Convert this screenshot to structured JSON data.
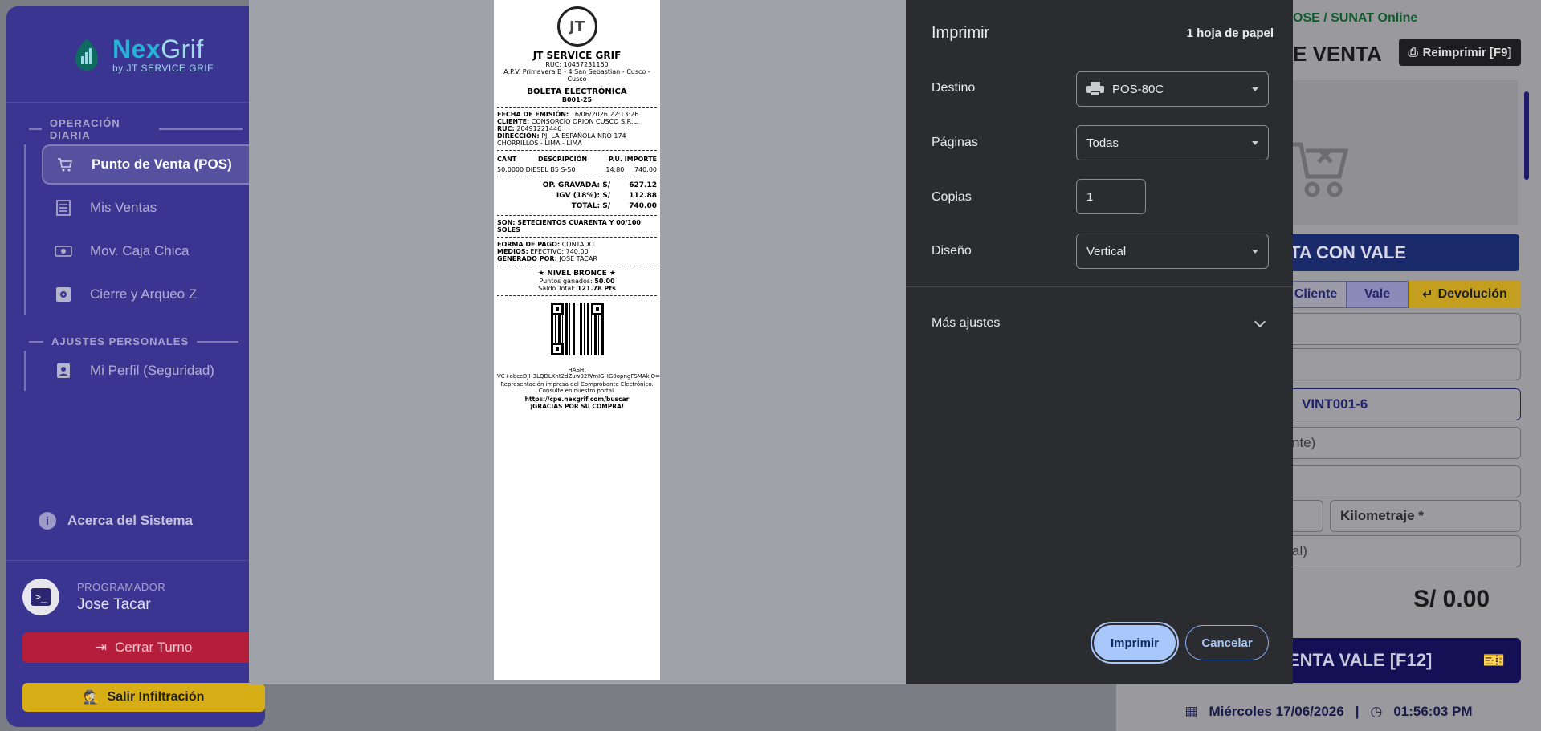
{
  "sidebar": {
    "brand_nex": "Nex",
    "brand_grif": "Grif",
    "brand_sub": "by JT SERVICE GRIF",
    "section_daily": "OPERACIÓN DIARIA",
    "daily_items": [
      {
        "label": "Punto de Venta (POS)",
        "icon": "cart-icon"
      },
      {
        "label": "Mis Ventas",
        "icon": "receipt-icon"
      },
      {
        "label": "Mov. Caja Chica",
        "icon": "cash-icon"
      },
      {
        "label": "Cierre y Arqueo Z",
        "icon": "safe-icon"
      }
    ],
    "section_personal": "AJUSTES PERSONALES",
    "personal_items": [
      {
        "label": "Mi Perfil (Seguridad)",
        "icon": "id-badge-icon"
      }
    ],
    "about": "Acerca del Sistema",
    "user_role": "PROGRAMADOR",
    "user_name": "Jose Tacar",
    "logout_label": "Cerrar Turno",
    "exit_label": "Salir Infiltración"
  },
  "right": {
    "status": "OSE / SUNAT Online",
    "title_partial": "E VENTA",
    "reprint": "Reimprimir [F9]",
    "banner": "TA CON VALE",
    "tabs": [
      "Cliente",
      "Vale",
      "Devolución"
    ],
    "field_vale": "VINT001-6",
    "field_client": "nte)",
    "field_km": "Kilometraje *",
    "field_total_label": "al)",
    "total": "S/ 0.00",
    "sell_button": "ENTA VALE [F12]",
    "date": "Miércoles 17/06/2026",
    "time": "01:56:03 PM"
  },
  "receipt": {
    "logo_text": "JT",
    "company": "JT SERVICE GRIF",
    "ruc": "RUC: 10457231160",
    "address": "A.P.V. Primavera B - 4 San Sebastian - Cusco - Cusco",
    "doc_type": "BOLETA ELECTRÓNICA",
    "doc_number": "B001-25",
    "issue_label": "FECHA DE EMISIÓN:",
    "issue_value": "16/06/2026 22:13:26",
    "client_label": "CLIENTE:",
    "client_value": "CONSORCIO ORION CUSCO S.R.L.",
    "client_ruc_label": "RUC:",
    "client_ruc_value": "20491221446",
    "dir_label": "DIRECCIÓN:",
    "dir_value": "PJ. LA ESPAÑOLA NRO 174 CHORRILLOS - LIMA - LIMA",
    "col_qty": "CANT",
    "col_desc": "DESCRIPCIÓN",
    "col_pu": "P.U.",
    "col_amount": "IMPORTE",
    "item_qty": "50.0000",
    "item_desc": "DIESEL B5 S-50",
    "item_pu": "14.80",
    "item_amount": "740.00",
    "op_label": "OP. GRAVADA: S/",
    "op_value": "627.12",
    "igv_label": "IGV (18%): S/",
    "igv_value": "112.88",
    "total_label": "TOTAL: S/",
    "total_value": "740.00",
    "words": "SON: SETECIENTOS CUARENTA Y 00/100 SOLES",
    "pay_label": "FORMA DE PAGO:",
    "pay_value": "CONTADO",
    "means_label": "MEDIOS:",
    "means_value": "EFECTIVO: 740.00",
    "gen_label": "GENERADO POR:",
    "gen_value": "JOSE TACAR",
    "level": "★ NIVEL BRONCE ★",
    "points_label": "Puntos ganados:",
    "points_value": "50.00",
    "balance_label": "Saldo Total:",
    "balance_value": "121.78 Pts",
    "hash_label": "HASH:",
    "hash_value": "VC+obccDJH3LQDLKnt2dZuw92WmIGHG0opngFSMAkjQ=",
    "printed_note": "Representación impresa del Comprobante Electrónico.",
    "consult_note": "Consulte en nuestro portal.",
    "url": "https://cpe.nexgrif.com/buscar",
    "thanks": "¡GRACIAS POR SU COMPRA!"
  },
  "print_dialog": {
    "title": "Imprimir",
    "sheets": "1 hoja de papel",
    "destination_label": "Destino",
    "destination_value": "POS-80C",
    "pages_label": "Páginas",
    "pages_value": "Todas",
    "copies_label": "Copias",
    "copies_value": "1",
    "layout_label": "Diseño",
    "layout_value": "Vertical",
    "more_settings": "Más ajustes",
    "print_button": "Imprimir",
    "cancel_button": "Cancelar"
  }
}
